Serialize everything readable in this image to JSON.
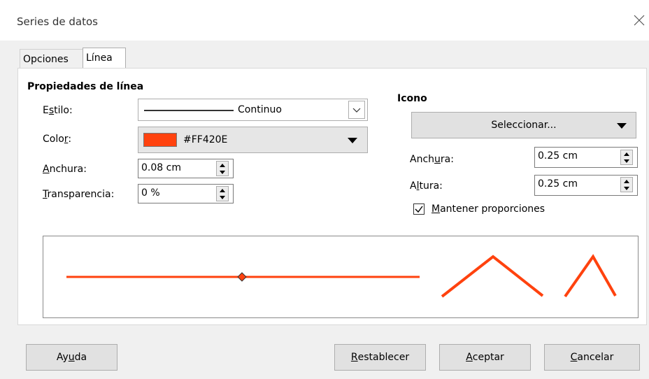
{
  "window": {
    "title": "Series de datos",
    "close_icon": "close-icon"
  },
  "tabs": [
    {
      "label": "Opciones",
      "active": false
    },
    {
      "label": "Línea",
      "active": true
    }
  ],
  "line_properties": {
    "section_title": "Propiedades de línea",
    "style": {
      "label_pre": "E",
      "label_u": "s",
      "label_post": "tilo:",
      "value": "Continuo"
    },
    "color": {
      "label_pre": "Colo",
      "label_u": "r",
      "label_post": ":",
      "value": "#FF420E",
      "swatch": "#FF420E"
    },
    "width": {
      "label_u": "A",
      "label_post": "nchura:",
      "value": "0.08 cm"
    },
    "transparency": {
      "label_u": "T",
      "label_post": "ransparencia:",
      "value": "0 %"
    }
  },
  "icon": {
    "section_title": "Icono",
    "select_label": "Seleccionar...",
    "width": {
      "label_pre": "Anch",
      "label_u": "u",
      "label_post": "ra:",
      "value": "0.25 cm"
    },
    "height": {
      "label_pre": "A",
      "label_u": "l",
      "label_post": "tura:",
      "value": "0.25 cm"
    },
    "keep_ratio": {
      "label_u": "M",
      "label_post": "antener proporciones",
      "checked": true
    }
  },
  "preview": {
    "line_color": "#FF420E"
  },
  "buttons": {
    "help": {
      "pre": "Ay",
      "u": "u",
      "post": "da"
    },
    "reset": {
      "pre": "",
      "u": "R",
      "post": "establecer"
    },
    "ok": {
      "pre": "",
      "u": "A",
      "post": "ceptar"
    },
    "cancel": {
      "pre": "",
      "u": "C",
      "post": "ancelar"
    }
  }
}
